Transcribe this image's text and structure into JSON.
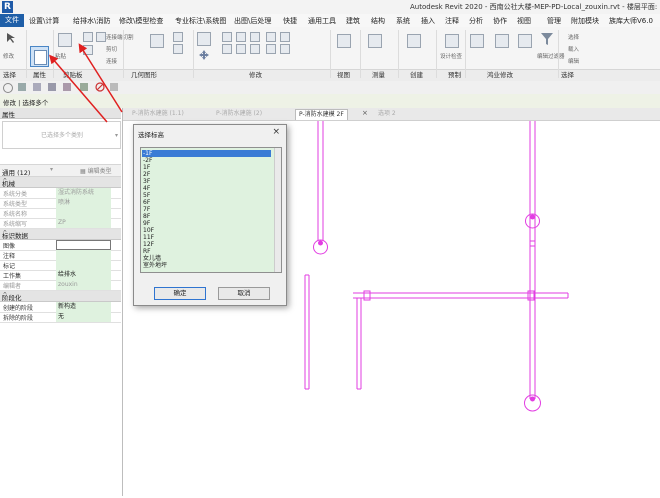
{
  "app": {
    "logo": "R",
    "title": "Autodesk Revit 2020 - 西南公社大楼-MEP-PD-Local_zouxin.rvt - 楼层平面: P-消防"
  },
  "menu": {
    "tabs": [
      "文件",
      "设置\\计算",
      "给排水\\消防",
      "修改\\模型检查",
      "专业标注\\系统图",
      "出图\\后处理",
      "快捷",
      "通用工具",
      "建筑",
      "结构",
      "系统",
      "插入",
      "注释",
      "分析",
      "协作",
      "视图",
      "管理",
      "附加模块",
      "族库大师V6.0"
    ]
  },
  "ribbon": {
    "groups": [
      "选择",
      "属性",
      "剪贴板",
      "几何图形",
      "修改",
      "视图",
      "测量",
      "创建",
      "预制",
      "鸿业修改",
      "选择"
    ],
    "small_buttons": [
      "连接端切割",
      "剪切",
      "连接",
      "修改",
      "粘贴",
      "激活",
      "尺寸标注",
      "创建组",
      "部件",
      "设计检查",
      "编辑过滤器",
      "选择",
      "载入",
      "编辑"
    ]
  },
  "modify_bar": {
    "text": "修改 | 选择多个"
  },
  "properties": {
    "header": "属性",
    "type_selector": "已选择多个类别",
    "filter_value": "通用 (12)",
    "edit_type_label": "编辑类型",
    "sections": [
      {
        "name": "机械",
        "rows": [
          {
            "key": "系统分类",
            "value": "湿式消防系统",
            "gray": true
          },
          {
            "key": "系统类型",
            "value": "喷淋",
            "gray": true
          },
          {
            "key": "系统名称",
            "value": "",
            "gray": true
          },
          {
            "key": "系统缩写",
            "value": "ZP",
            "gray": true
          }
        ]
      },
      {
        "name": "标识数据",
        "rows": [
          {
            "key": "图像",
            "value": "",
            "gray": false,
            "white": true
          },
          {
            "key": "注释",
            "value": "",
            "gray": false
          },
          {
            "key": "标记",
            "value": "",
            "gray": false
          },
          {
            "key": "工作集",
            "value": "给排水",
            "gray": false
          },
          {
            "key": "编辑者",
            "value": "zouxin",
            "gray": true
          }
        ]
      },
      {
        "name": "阶段化",
        "rows": [
          {
            "key": "创建的阶段",
            "value": "新构造",
            "gray": false
          },
          {
            "key": "拆除的阶段",
            "value": "无",
            "gray": false
          }
        ]
      }
    ]
  },
  "view_tabs": [
    {
      "label": "P-消防水建施 (1.1)",
      "active": false
    },
    {
      "label": "P-消防水建施 (2)",
      "active": false
    },
    {
      "label": "P-消防水建模 2F",
      "active": true
    },
    {
      "label": "选项 2",
      "active": false
    }
  ],
  "dialog": {
    "title": "选择标高",
    "close": "×",
    "levels": [
      "-1F",
      "-2F",
      "1F",
      "2F",
      "3F",
      "4F",
      "5F",
      "6F",
      "7F",
      "8F",
      "9F",
      "10F",
      "11F",
      "12F",
      "RF",
      "女儿墙",
      "室外地坪"
    ],
    "selected_index": 0,
    "ok_label": "确定",
    "cancel_label": "取消"
  },
  "colors": {
    "accent": "#1f5fa8",
    "pipe": "#e23de2",
    "arrow": "#e02020",
    "property_value_bg": "#dff2df"
  }
}
